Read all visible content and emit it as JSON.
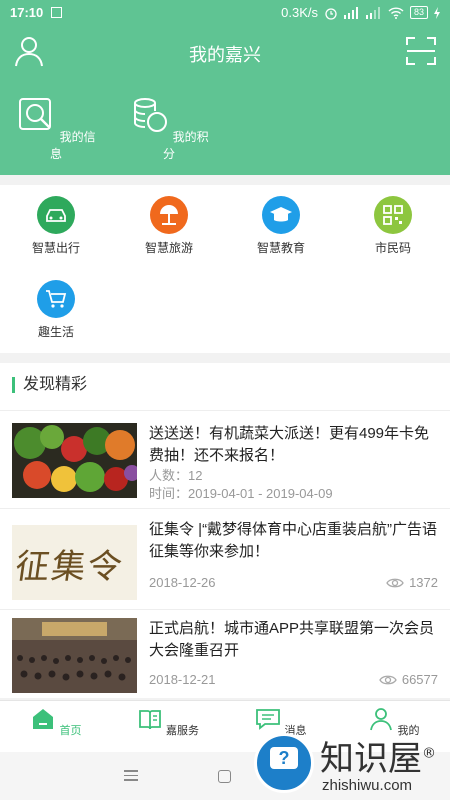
{
  "statusbar": {
    "time": "17:10",
    "network": "0.3K/s",
    "battery": "83"
  },
  "header": {
    "title": "我的嘉兴",
    "items": [
      {
        "label": "我的信息",
        "icon": "search-doc-icon"
      },
      {
        "label": "我的积分",
        "icon": "coins-icon"
      }
    ]
  },
  "services": [
    {
      "label": "智慧出行",
      "icon": "car-icon",
      "color": "#2ea95c"
    },
    {
      "label": "智慧旅游",
      "icon": "umbrella-icon",
      "color": "#f0691d"
    },
    {
      "label": "智慧教育",
      "icon": "graduation-cap-icon",
      "color": "#1f9ee8"
    },
    {
      "label": "市民码",
      "icon": "qr-code-icon",
      "color": "#8dc63f"
    },
    {
      "label": "趣生活",
      "icon": "cart-icon",
      "color": "#1f9ee8"
    }
  ],
  "discover": {
    "title": "发现精彩",
    "articles": [
      {
        "title": "送送送！有机蔬菜大派送！更有499年卡免费抽！还不来报名！",
        "count": "人数：12",
        "time": "时间：2019-04-01 - 2019-04-09"
      },
      {
        "title": "征集令 |“戴梦得体育中心店重装启航”广告语征集等你来参加！",
        "date": "2018-12-26",
        "views": "1372",
        "thumb_text": "征集令"
      },
      {
        "title": "正式启航！城市通APP共享联盟第一次会员大会隆重召开",
        "date": "2018-12-21",
        "views": "66577"
      }
    ]
  },
  "bottomnav": [
    {
      "label": "首页",
      "icon": "home-icon",
      "active": true
    },
    {
      "label": "嘉服务",
      "icon": "service-icon",
      "active": false
    },
    {
      "label": "消息",
      "icon": "message-icon",
      "active": false
    },
    {
      "label": "我的",
      "icon": "profile-icon",
      "active": false
    }
  ],
  "watermark": {
    "cn": "知识屋",
    "en": "zhishiwu.com",
    "reg": "®"
  },
  "colors": {
    "primary": "#5fc493",
    "accent": "#3cc07a"
  }
}
